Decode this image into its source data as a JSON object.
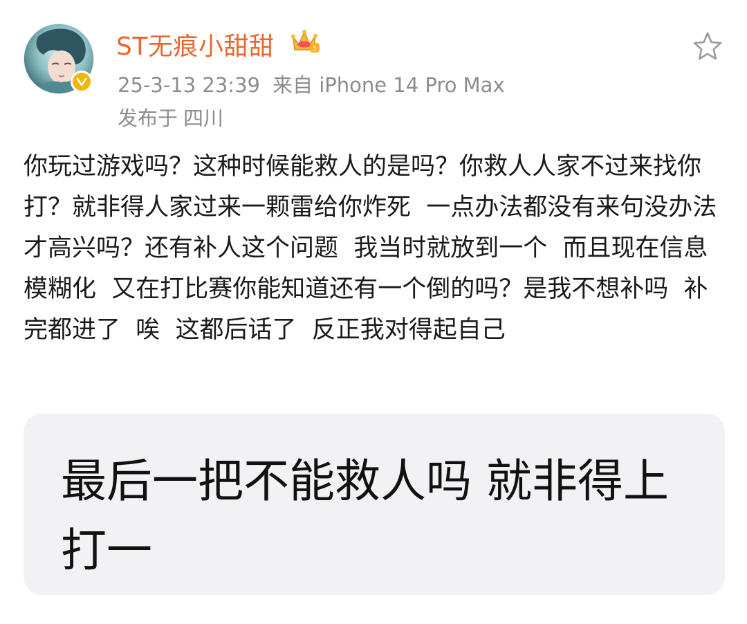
{
  "post": {
    "username": "ST无痕小甜甜",
    "timestamp": "25-3-13 23:39",
    "source": "来自 iPhone 14 Pro Max",
    "location_prefix": "发布于",
    "location": "四川",
    "text": "你玩过游戏吗？这种时候能救人的是吗？你救人人家不过来找你打？就非得人家过来一颗雷给你炸死  一点办法都没有来句没办法才高兴吗？还有补人这个问题  我当时就放到一个  而且现在信息模糊化  又在打比赛你能知道还有一个倒的吗？是我不想补吗  补完都进了  唉  这都后话了  反正我对得起自己"
  },
  "image": {
    "line1": "最后一把不能救人吗  就非得上",
    "line2": "打一"
  },
  "icons": {
    "avatar": "avatar",
    "verified": "verified-badge-icon",
    "crown": "crown-level-icon",
    "favorite": "star-icon"
  },
  "colors": {
    "username": "#e8672c",
    "meta": "#8c8c8c",
    "verified": "#f2b705",
    "image_bg": "#f2f2f4"
  }
}
